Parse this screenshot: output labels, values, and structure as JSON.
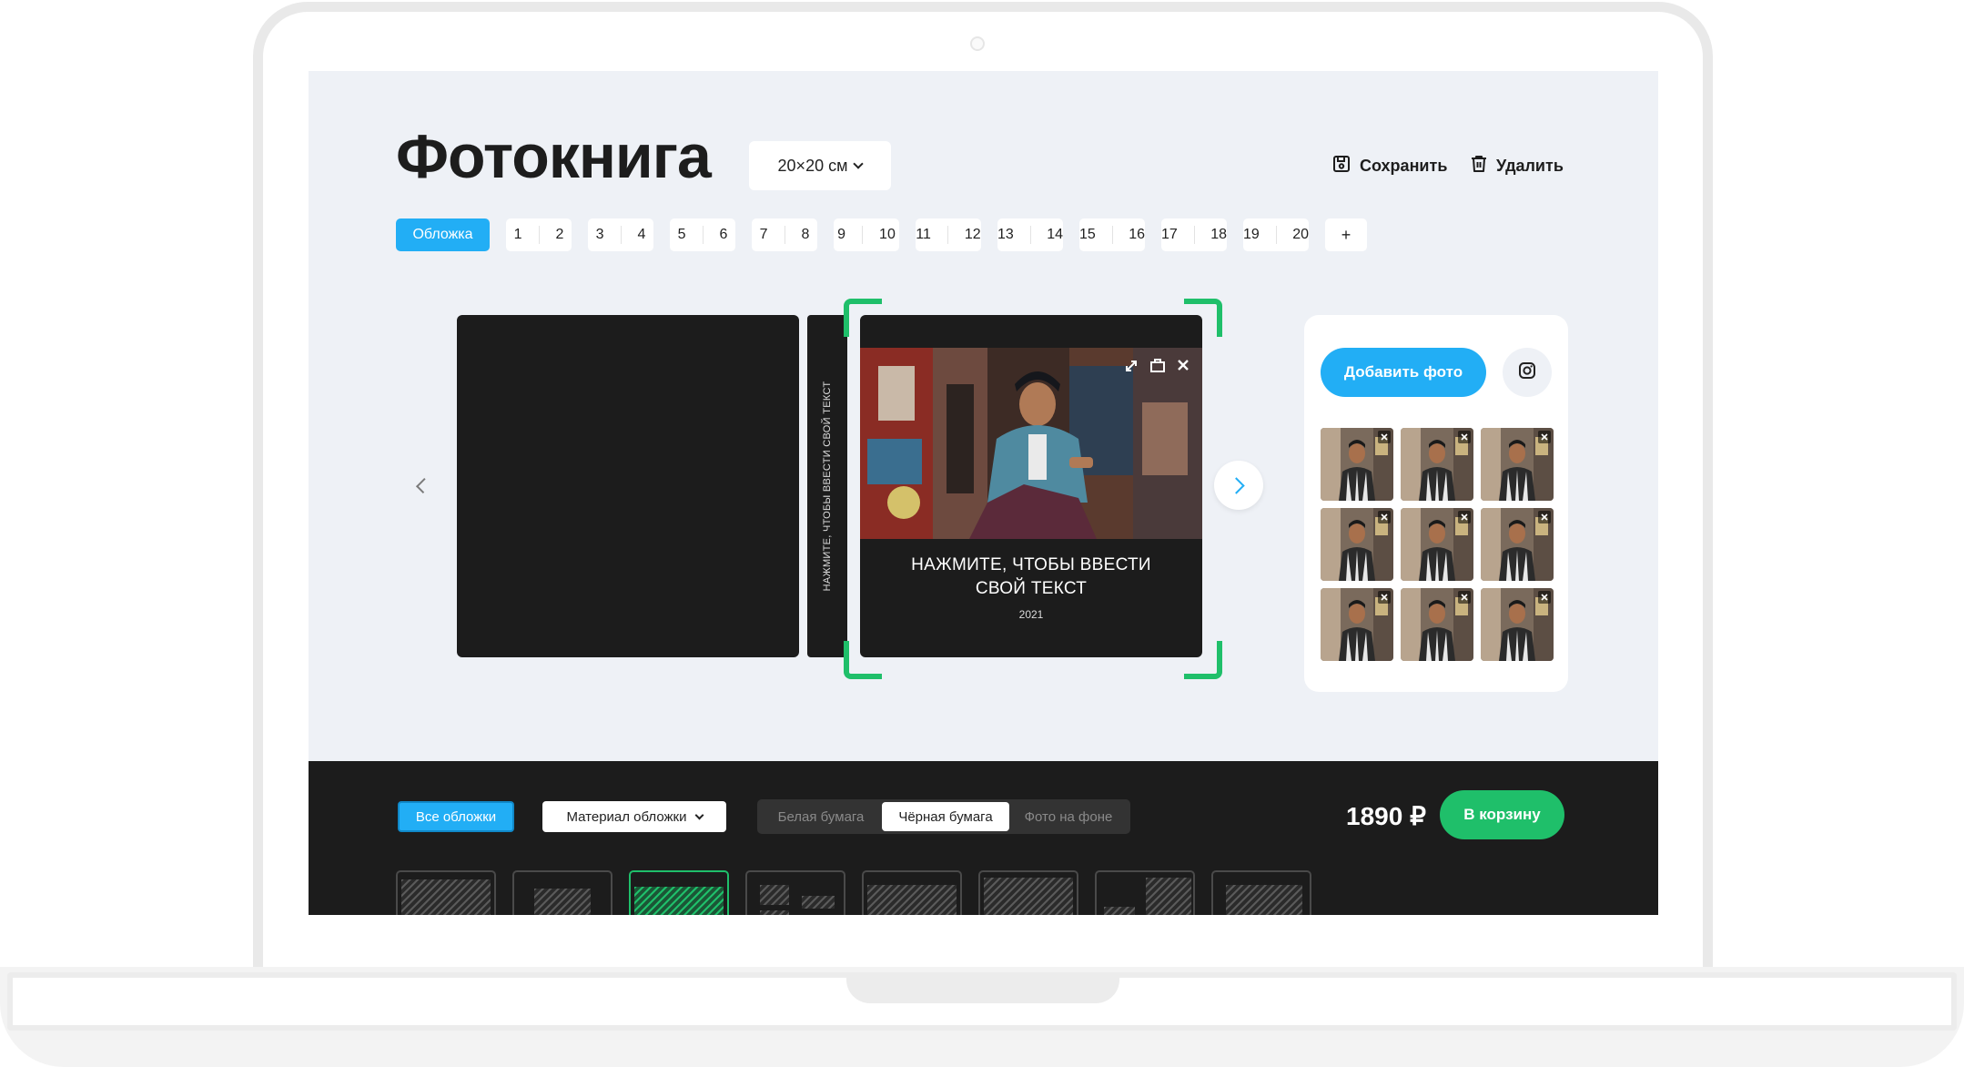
{
  "app": {
    "title": "Фотокнига",
    "size_value": "20×20 см",
    "save_label": "Сохранить",
    "delete_label": "Удалить"
  },
  "pages": {
    "cover_label": "Обложка",
    "spreads": [
      [
        "1",
        "2"
      ],
      [
        "3",
        "4"
      ],
      [
        "5",
        "6"
      ],
      [
        "7",
        "8"
      ],
      [
        "9",
        "10"
      ],
      [
        "11",
        "12"
      ],
      [
        "13",
        "14"
      ],
      [
        "15",
        "16"
      ],
      [
        "17",
        "18"
      ],
      [
        "19",
        "20"
      ]
    ],
    "add_label": "+"
  },
  "editor": {
    "spine_text": "НАЖМИТЕ, ЧТОБЫ ВВЕСТИ СВОЙ ТЕКСТ",
    "cover_text_line1": "НАЖМИТЕ, ЧТОБЫ ВВЕСТИ",
    "cover_text_line2": "СВОЙ ТЕКСТ",
    "year": "2021",
    "photo_tools": [
      "expand-icon",
      "crop-icon",
      "close-icon"
    ]
  },
  "photos_panel": {
    "add_photo_label": "Добавить фото",
    "instagram_icon": "instagram-icon",
    "photo_count": 9
  },
  "bottom": {
    "all_covers_label": "Все обложки",
    "material_label": "Материал обложки",
    "paper_options": [
      "Белая бумага",
      "Чёрная бумага",
      "Фото на фоне"
    ],
    "paper_selected": "Чёрная бумага",
    "price": "1890 ₽",
    "cart_label": "В корзину"
  },
  "colors": {
    "accent": "#22aef5",
    "success": "#1fbf6a",
    "dark": "#1c1c1c",
    "screen_bg": "#eef1f6"
  }
}
